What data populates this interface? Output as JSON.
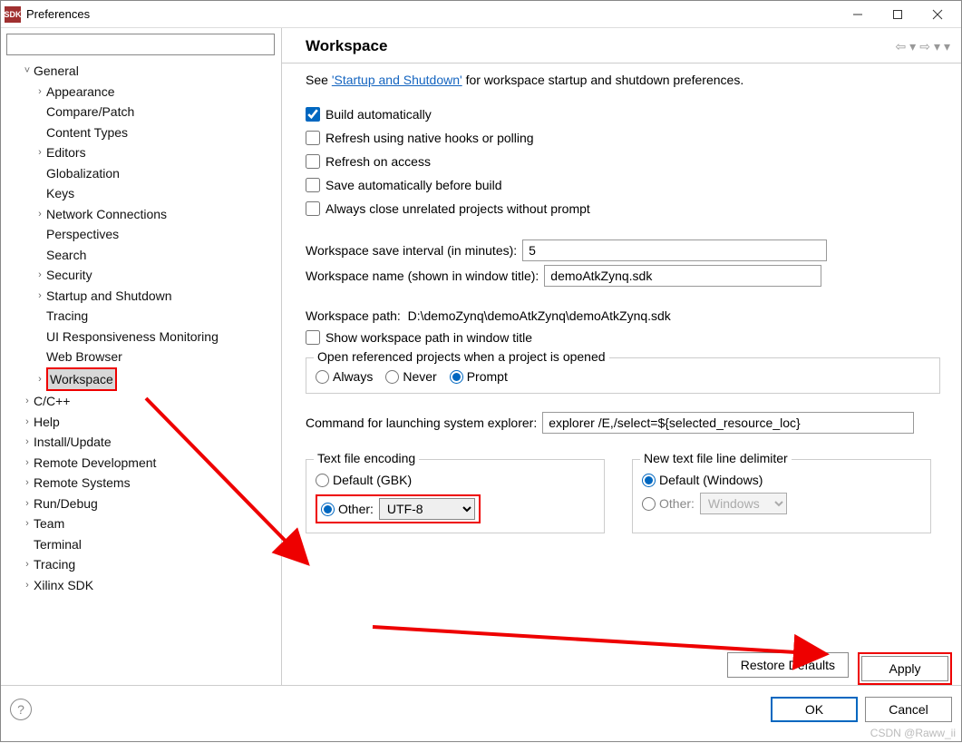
{
  "window": {
    "title": "Preferences",
    "app_icon_text": "SDK"
  },
  "tree": {
    "general": {
      "label": "General",
      "appearance": "Appearance",
      "compare_patch": "Compare/Patch",
      "content_types": "Content Types",
      "editors": "Editors",
      "globalization": "Globalization",
      "keys": "Keys",
      "network_connections": "Network Connections",
      "perspectives": "Perspectives",
      "search": "Search",
      "security": "Security",
      "startup_shutdown": "Startup and Shutdown",
      "tracing": "Tracing",
      "ui_responsiveness": "UI Responsiveness Monitoring",
      "web_browser": "Web Browser",
      "workspace": "Workspace"
    },
    "cpp": "C/C++",
    "help": "Help",
    "install_update": "Install/Update",
    "remote_development": "Remote Development",
    "remote_systems": "Remote Systems",
    "run_debug": "Run/Debug",
    "team": "Team",
    "terminal": "Terminal",
    "tracing2": "Tracing",
    "xilinx_sdk": "Xilinx SDK"
  },
  "page": {
    "heading": "Workspace",
    "see_prefix": "See ",
    "see_link": "'Startup and Shutdown'",
    "see_suffix": " for workspace startup and shutdown preferences.",
    "chk_build_auto": "Build automatically",
    "chk_refresh_hooks": "Refresh using native hooks or polling",
    "chk_refresh_access": "Refresh on access",
    "chk_save_before_build": "Save automatically before build",
    "chk_close_unrelated": "Always close unrelated projects without prompt",
    "save_interval_label": "Workspace save interval (in minutes):",
    "save_interval_value": "5",
    "ws_name_label": "Workspace name (shown in window title):",
    "ws_name_value": "demoAtkZynq.sdk",
    "ws_path_label": "Workspace path:",
    "ws_path_value": "D:\\demoZynq\\demoAtkZynq\\demoAtkZynq.sdk",
    "chk_show_ws_path": "Show workspace path in window title",
    "open_ref_legend": "Open referenced projects when a project is opened",
    "r_always": "Always",
    "r_never": "Never",
    "r_prompt": "Prompt",
    "cmd_explorer_label": "Command for launching system explorer:",
    "cmd_explorer_value": "explorer /E,/select=${selected_resource_loc}",
    "enc_legend": "Text file encoding",
    "enc_default": "Default (GBK)",
    "enc_other": "Other:",
    "enc_other_value": "UTF-8",
    "delim_legend": "New text file line delimiter",
    "delim_default": "Default (Windows)",
    "delim_other": "Other:",
    "delim_other_value": "Windows",
    "btn_restore_defaults": "Restore Defaults",
    "btn_apply": "Apply",
    "btn_ok": "OK",
    "btn_cancel": "Cancel"
  },
  "watermark": "CSDN @Raww_ii"
}
